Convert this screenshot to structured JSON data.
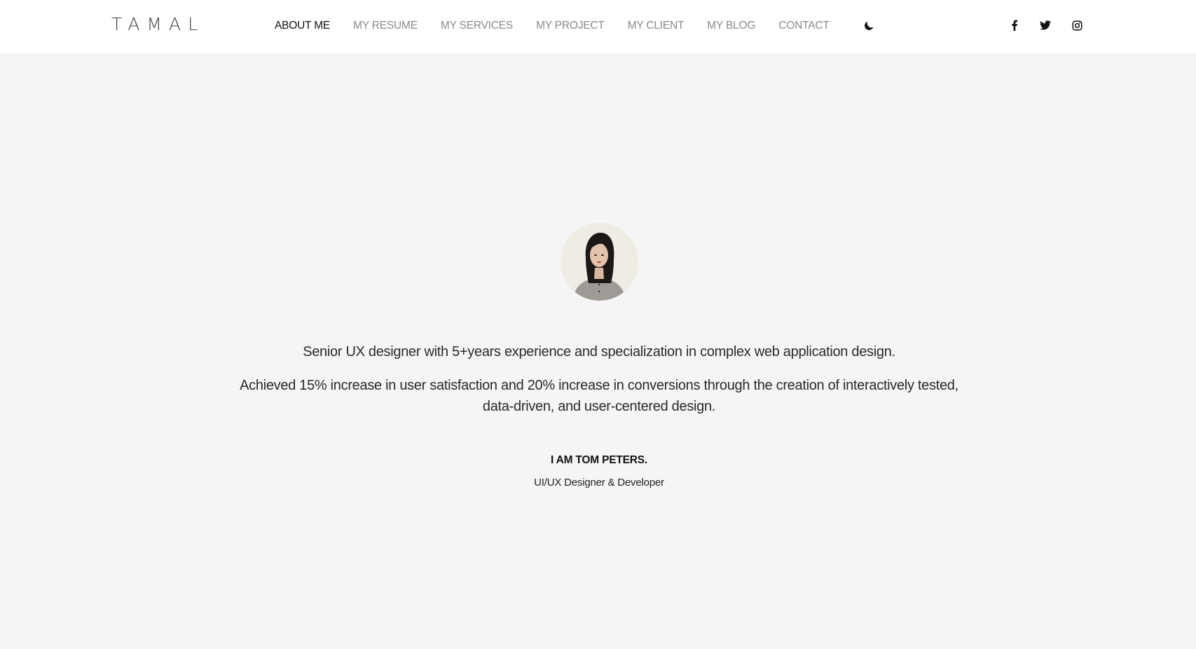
{
  "header": {
    "logo": "TAMAL",
    "nav": [
      {
        "label": "ABOUT ME",
        "active": true
      },
      {
        "label": "MY RESUME",
        "active": false
      },
      {
        "label": "MY SERVICES",
        "active": false
      },
      {
        "label": "MY PROJECT",
        "active": false
      },
      {
        "label": "MY CLIENT",
        "active": false
      },
      {
        "label": "MY BLOG",
        "active": false
      },
      {
        "label": "CONTACT",
        "active": false
      }
    ],
    "theme_toggle_icon": "moon-icon",
    "social": [
      "facebook-icon",
      "twitter-icon",
      "instagram-icon"
    ]
  },
  "profile": {
    "bio_line1": "Senior UX designer with 5+years experience and specialization in complex web application design.",
    "bio_line2": "Achieved 15% increase in user satisfaction and 20% increase in conversions through the creation of interactively tested, data-driven, and user-centered design.",
    "name": "I AM TOM PETERS.",
    "role": "UI/UX Designer & Developer"
  },
  "colors": {
    "page_bg": "#f5f5f5",
    "header_bg": "#ffffff",
    "nav_inactive": "#8a8a8a",
    "nav_active": "#111111"
  }
}
